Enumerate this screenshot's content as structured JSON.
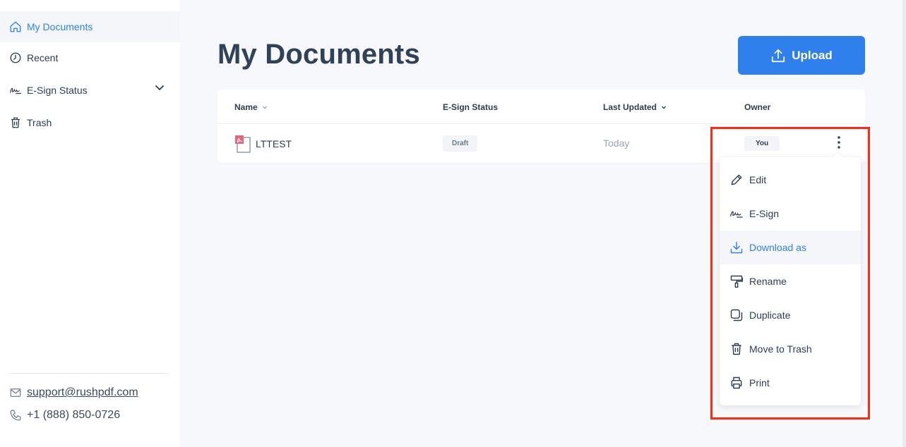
{
  "sidebar": {
    "items": [
      {
        "label": "My Documents",
        "icon": "home-icon",
        "active": true
      },
      {
        "label": "Recent",
        "icon": "clock-icon"
      },
      {
        "label": "E-Sign Status",
        "icon": "signature-icon"
      },
      {
        "label": "Trash",
        "icon": "trash-icon"
      }
    ],
    "email": "support@rushpdf.com",
    "phone": "+1 (888) 850-0726"
  },
  "main": {
    "title": "My Documents",
    "upload_label": "Upload",
    "table": {
      "headers": {
        "name": "Name",
        "esign": "E-Sign Status",
        "updated": "Last Updated",
        "owner": "Owner"
      },
      "rows": [
        {
          "name": "LTTEST",
          "status": "Draft",
          "updated": "Today",
          "owner": "You"
        }
      ]
    }
  },
  "context_menu": {
    "items": [
      {
        "label": "Edit",
        "icon": "pencil-icon"
      },
      {
        "label": "E-Sign",
        "icon": "signature-icon"
      },
      {
        "label": "Download as",
        "icon": "download-icon",
        "hover": true
      },
      {
        "label": "Rename",
        "icon": "paint-roller-icon"
      },
      {
        "label": "Duplicate",
        "icon": "duplicate-icon"
      },
      {
        "label": "Move to Trash",
        "icon": "trash-icon"
      },
      {
        "label": "Print",
        "icon": "printer-icon"
      }
    ]
  },
  "colors": {
    "accent": "#2f80ed",
    "highlight": "#ff2a12",
    "title": "#2f4258"
  }
}
